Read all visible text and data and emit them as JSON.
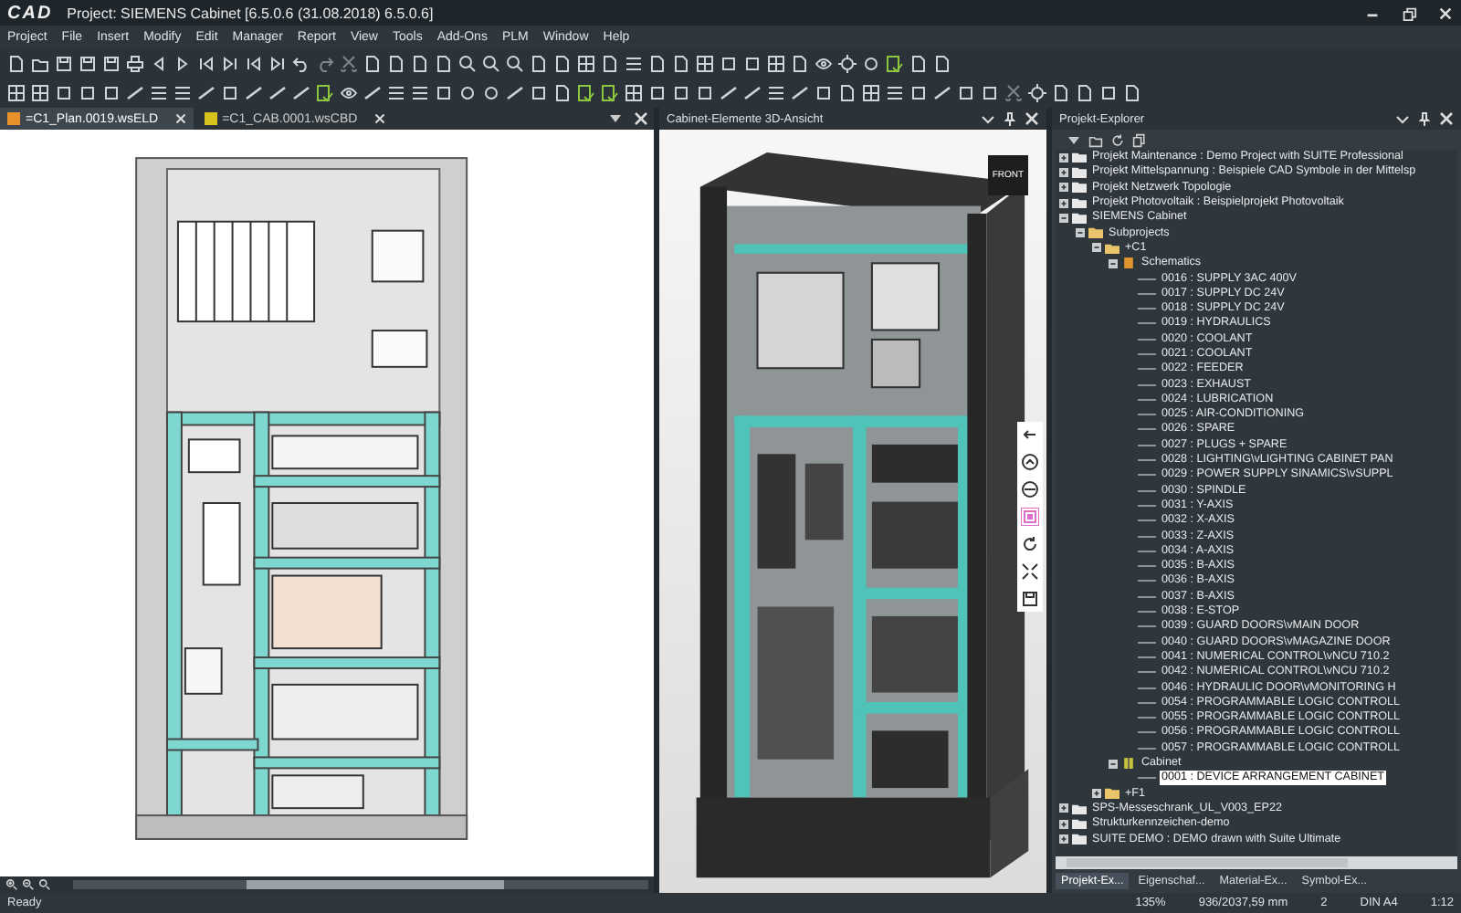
{
  "window": {
    "logo": "CAD",
    "title": "Project: SIEMENS Cabinet  [6.5.0.6 (31.08.2018) 6.5.0.6]"
  },
  "menu": [
    "Project",
    "File",
    "Insert",
    "Modify",
    "Edit",
    "Manager",
    "Report",
    "View",
    "Tools",
    "Add-Ons",
    "PLM",
    "Window",
    "Help"
  ],
  "document_tabs": [
    {
      "label": "=C1_Plan.0019.wsELD",
      "kind": "plan",
      "selected": true
    },
    {
      "label": "=C1_CAB.0001.wsCBD",
      "kind": "cabinet",
      "selected": false
    }
  ],
  "view_panel": {
    "title": "Cabinet-Elemente 3D-Ansicht",
    "view_cube": "FRONT"
  },
  "explorer": {
    "title": "Projekt-Explorer",
    "tree": [
      {
        "label": "Projekt Maintenance : Demo Project with SUITE Professional",
        "kind": "project",
        "expanded": false,
        "selected": false
      },
      {
        "label": "Projekt Mittelspannung : Beispiele CAD Symbole in der Mittelsp",
        "kind": "project",
        "expanded": false,
        "selected": false
      },
      {
        "label": "Projekt Netzwerk Topologie",
        "kind": "project",
        "expanded": false,
        "selected": false
      },
      {
        "label": "Projekt Photovoltaik : Beispielprojekt Photovoltaik",
        "kind": "project",
        "expanded": false,
        "selected": false
      },
      {
        "label": "SIEMENS Cabinet",
        "kind": "project",
        "expanded": true,
        "selected": false,
        "children": [
          {
            "label": "Subprojects",
            "kind": "folder",
            "expanded": true,
            "selected": false,
            "children": [
              {
                "label": "+C1",
                "kind": "folder",
                "expanded": true,
                "selected": false,
                "children": [
                  {
                    "label": "Schematics",
                    "kind": "schematics",
                    "expanded": true,
                    "selected": false,
                    "children": [
                      {
                        "label": "0016 : SUPPLY 3AC 400V",
                        "kind": "page",
                        "selected": false
                      },
                      {
                        "label": "0017 : SUPPLY DC 24V",
                        "kind": "page",
                        "selected": false
                      },
                      {
                        "label": "0018 : SUPPLY DC 24V",
                        "kind": "page",
                        "selected": false
                      },
                      {
                        "label": "0019 : HYDRAULICS",
                        "kind": "page",
                        "selected": false
                      },
                      {
                        "label": "0020 : COOLANT",
                        "kind": "page",
                        "selected": false
                      },
                      {
                        "label": "0021 : COOLANT",
                        "kind": "page",
                        "selected": false
                      },
                      {
                        "label": "0022 : FEEDER",
                        "kind": "page",
                        "selected": false
                      },
                      {
                        "label": "0023 : EXHAUST",
                        "kind": "page",
                        "selected": false
                      },
                      {
                        "label": "0024 : LUBRICATION",
                        "kind": "page",
                        "selected": false
                      },
                      {
                        "label": "0025 : AIR-CONDITIONING",
                        "kind": "page",
                        "selected": false
                      },
                      {
                        "label": "0026 : SPARE",
                        "kind": "page",
                        "selected": false
                      },
                      {
                        "label": "0027 : PLUGS + SPARE",
                        "kind": "page",
                        "selected": false
                      },
                      {
                        "label": "0028 : LIGHTING\\vLIGHTING CABINET PAN",
                        "kind": "page",
                        "selected": false
                      },
                      {
                        "label": "0029 : POWER SUPPLY SINAMICS\\vSUPPL",
                        "kind": "page",
                        "selected": false
                      },
                      {
                        "label": "0030 : SPINDLE",
                        "kind": "page",
                        "selected": false
                      },
                      {
                        "label": "0031 : Y-AXIS",
                        "kind": "page",
                        "selected": false
                      },
                      {
                        "label": "0032 : X-AXIS",
                        "kind": "page",
                        "selected": false
                      },
                      {
                        "label": "0033 : Z-AXIS",
                        "kind": "page",
                        "selected": false
                      },
                      {
                        "label": "0034 : A-AXIS",
                        "kind": "page",
                        "selected": false
                      },
                      {
                        "label": "0035 : B-AXIS",
                        "kind": "page",
                        "selected": false
                      },
                      {
                        "label": "0036 : B-AXIS",
                        "kind": "page",
                        "selected": false
                      },
                      {
                        "label": "0037 : B-AXIS",
                        "kind": "page",
                        "selected": false
                      },
                      {
                        "label": "0038 : E-STOP",
                        "kind": "page",
                        "selected": false
                      },
                      {
                        "label": "0039 : GUARD DOORS\\vMAIN DOOR",
                        "kind": "page",
                        "selected": false
                      },
                      {
                        "label": "0040 : GUARD DOORS\\vMAGAZINE DOOR",
                        "kind": "page",
                        "selected": false
                      },
                      {
                        "label": "0041 : NUMERICAL CONTROL\\vNCU 710.2",
                        "kind": "page",
                        "selected": false
                      },
                      {
                        "label": "0042 : NUMERICAL CONTROL\\vNCU 710.2",
                        "kind": "page",
                        "selected": false
                      },
                      {
                        "label": "0046 : HYDRAULIC DOOR\\vMONITORING H",
                        "kind": "page",
                        "selected": false
                      },
                      {
                        "label": "0054 : PROGRAMMABLE LOGIC CONTROLL",
                        "kind": "page",
                        "selected": false
                      },
                      {
                        "label": "0055 : PROGRAMMABLE LOGIC CONTROLL",
                        "kind": "page",
                        "selected": false
                      },
                      {
                        "label": "0056 : PROGRAMMABLE LOGIC CONTROLL",
                        "kind": "page",
                        "selected": false
                      },
                      {
                        "label": "0057 : PROGRAMMABLE LOGIC CONTROLL",
                        "kind": "page",
                        "selected": false
                      }
                    ]
                  },
                  {
                    "label": "Cabinet",
                    "kind": "cabinet",
                    "expanded": true,
                    "selected": false,
                    "children": [
                      {
                        "label": "0001 : DEVICE ARRANGEMENT CABINET",
                        "kind": "page",
                        "selected": true
                      }
                    ]
                  }
                ]
              },
              {
                "label": "+F1",
                "kind": "folder",
                "expanded": false,
                "selected": false
              }
            ]
          }
        ]
      },
      {
        "label": "SPS-Messeschrank_UL_V003_EP22",
        "kind": "project",
        "expanded": false,
        "selected": false
      },
      {
        "label": "Strukturkennzeichen-demo",
        "kind": "project",
        "expanded": false,
        "selected": false
      },
      {
        "label": "SUITE DEMO : DEMO drawn with Suite Ultimate",
        "kind": "project",
        "expanded": false,
        "selected": false
      }
    ],
    "bottom_tabs": [
      {
        "label": "Projekt-Ex...",
        "selected": true
      },
      {
        "label": "Eigenschaf...",
        "selected": false
      },
      {
        "label": "Material-Ex...",
        "selected": false
      },
      {
        "label": "Symbol-Ex...",
        "selected": false
      }
    ]
  },
  "status_bar": {
    "state": "Ready",
    "zoom": "135%",
    "position": "936/2037,59 mm",
    "page": "2",
    "format": "DIN A4",
    "scale": "1:12"
  }
}
